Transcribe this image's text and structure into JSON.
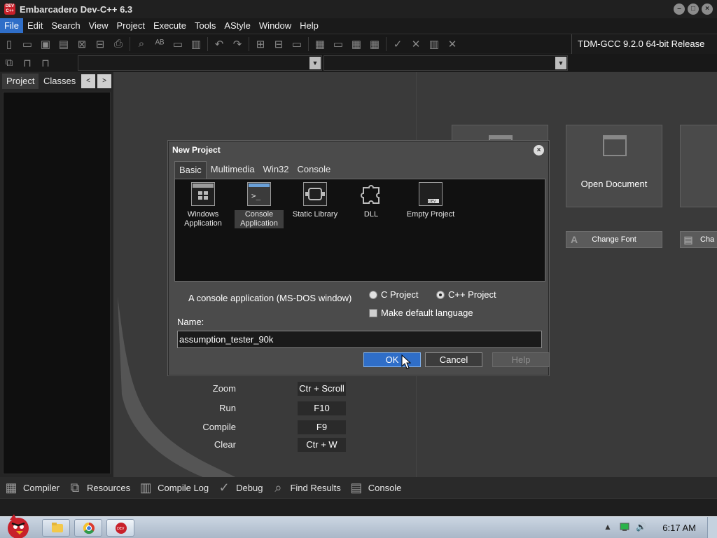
{
  "window": {
    "title": "Embarcadero Dev-C++ 6.3",
    "app_icon_text": "DEV C++"
  },
  "menu": [
    "File",
    "Edit",
    "Search",
    "View",
    "Project",
    "Execute",
    "Tools",
    "AStyle",
    "Window",
    "Help"
  ],
  "toolbar": {
    "compiler": "TDM-GCC 9.2.0 64-bit Release"
  },
  "left_panel": {
    "tabs": [
      "Project",
      "Classes"
    ],
    "prev": "<",
    "next": ">"
  },
  "welcome": {
    "tiles": [
      "Open Document"
    ],
    "font_buttons": [
      "Change Font",
      "Cha"
    ],
    "shortcuts": [
      {
        "name": "Zoom",
        "key": "Ctr + Scroll"
      },
      {
        "name": "Run",
        "key": "F10"
      },
      {
        "name": "Compile",
        "key": "F9"
      },
      {
        "name": "Clear",
        "key": "Ctr + W"
      }
    ]
  },
  "dialog": {
    "title": "New Project",
    "tabs": [
      "Basic",
      "Multimedia",
      "Win32",
      "Console"
    ],
    "projects": [
      {
        "label_1": "Windows",
        "label_2": "Application",
        "icon": "window-app-icon"
      },
      {
        "label_1": "Console",
        "label_2": "Application",
        "icon": "console-app-icon"
      },
      {
        "label_1": "Static Library",
        "label_2": "",
        "icon": "static-library-icon"
      },
      {
        "label_1": "DLL",
        "label_2": "",
        "icon": "dll-puzzle-icon"
      },
      {
        "label_1": "Empty Project",
        "label_2": "",
        "icon": "empty-project-icon"
      }
    ],
    "description": "A console application (MS-DOS window)",
    "c_project": "C Project",
    "cpp_project": "C++ Project",
    "make_default": "Make default language",
    "name_label": "Name:",
    "name_value": "assumption_tester_90k",
    "ok": "OK",
    "cancel": "Cancel",
    "help": "Help"
  },
  "dock": [
    "Compiler",
    "Resources",
    "Compile Log",
    "Debug",
    "Find Results",
    "Console"
  ],
  "taskbar": {
    "clock": "6:17 AM"
  },
  "colors": {
    "accent": "#2f6ec8",
    "background": "#3a3a3a"
  }
}
